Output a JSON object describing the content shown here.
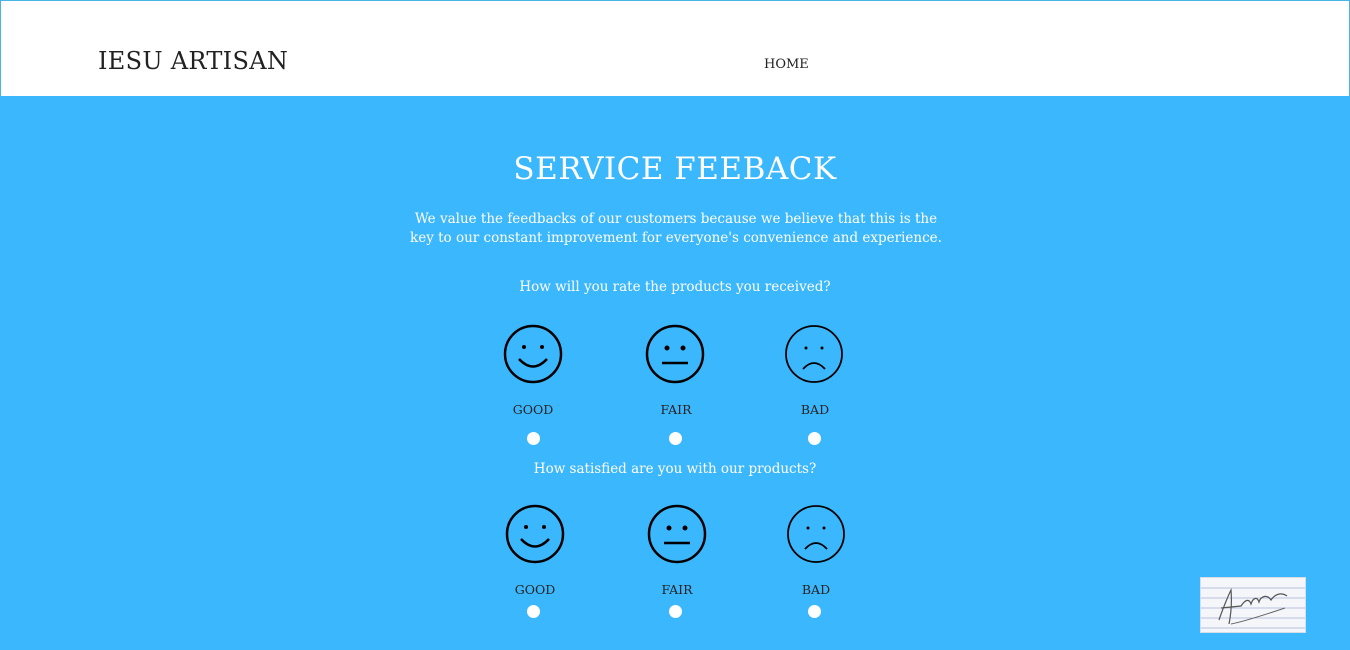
{
  "header": {
    "brand": "IESU ARTISAN",
    "nav": {
      "home": "HOME"
    }
  },
  "main": {
    "title": "SERVICE FEEBACK",
    "intro": "We value the feedbacks of our customers because we believe that this is the key to our constant improvement for everyone's convenience and experience.",
    "questions": [
      {
        "text": "How will you rate the products you received?",
        "options": [
          {
            "label": "GOOD",
            "icon": "smile-face-icon"
          },
          {
            "label": "FAIR",
            "icon": "neutral-face-icon"
          },
          {
            "label": "BAD",
            "icon": "sad-face-icon"
          }
        ]
      },
      {
        "text": "How satisfied are you with our products?",
        "options": [
          {
            "label": "GOOD",
            "icon": "smile-face-icon"
          },
          {
            "label": "FAIR",
            "icon": "neutral-face-icon"
          },
          {
            "label": "BAD",
            "icon": "sad-face-icon"
          }
        ]
      }
    ]
  },
  "colors": {
    "background": "#3bb7fd",
    "header": "#ffffff",
    "text_light": "#ffffff",
    "text_dark": "#222222"
  }
}
